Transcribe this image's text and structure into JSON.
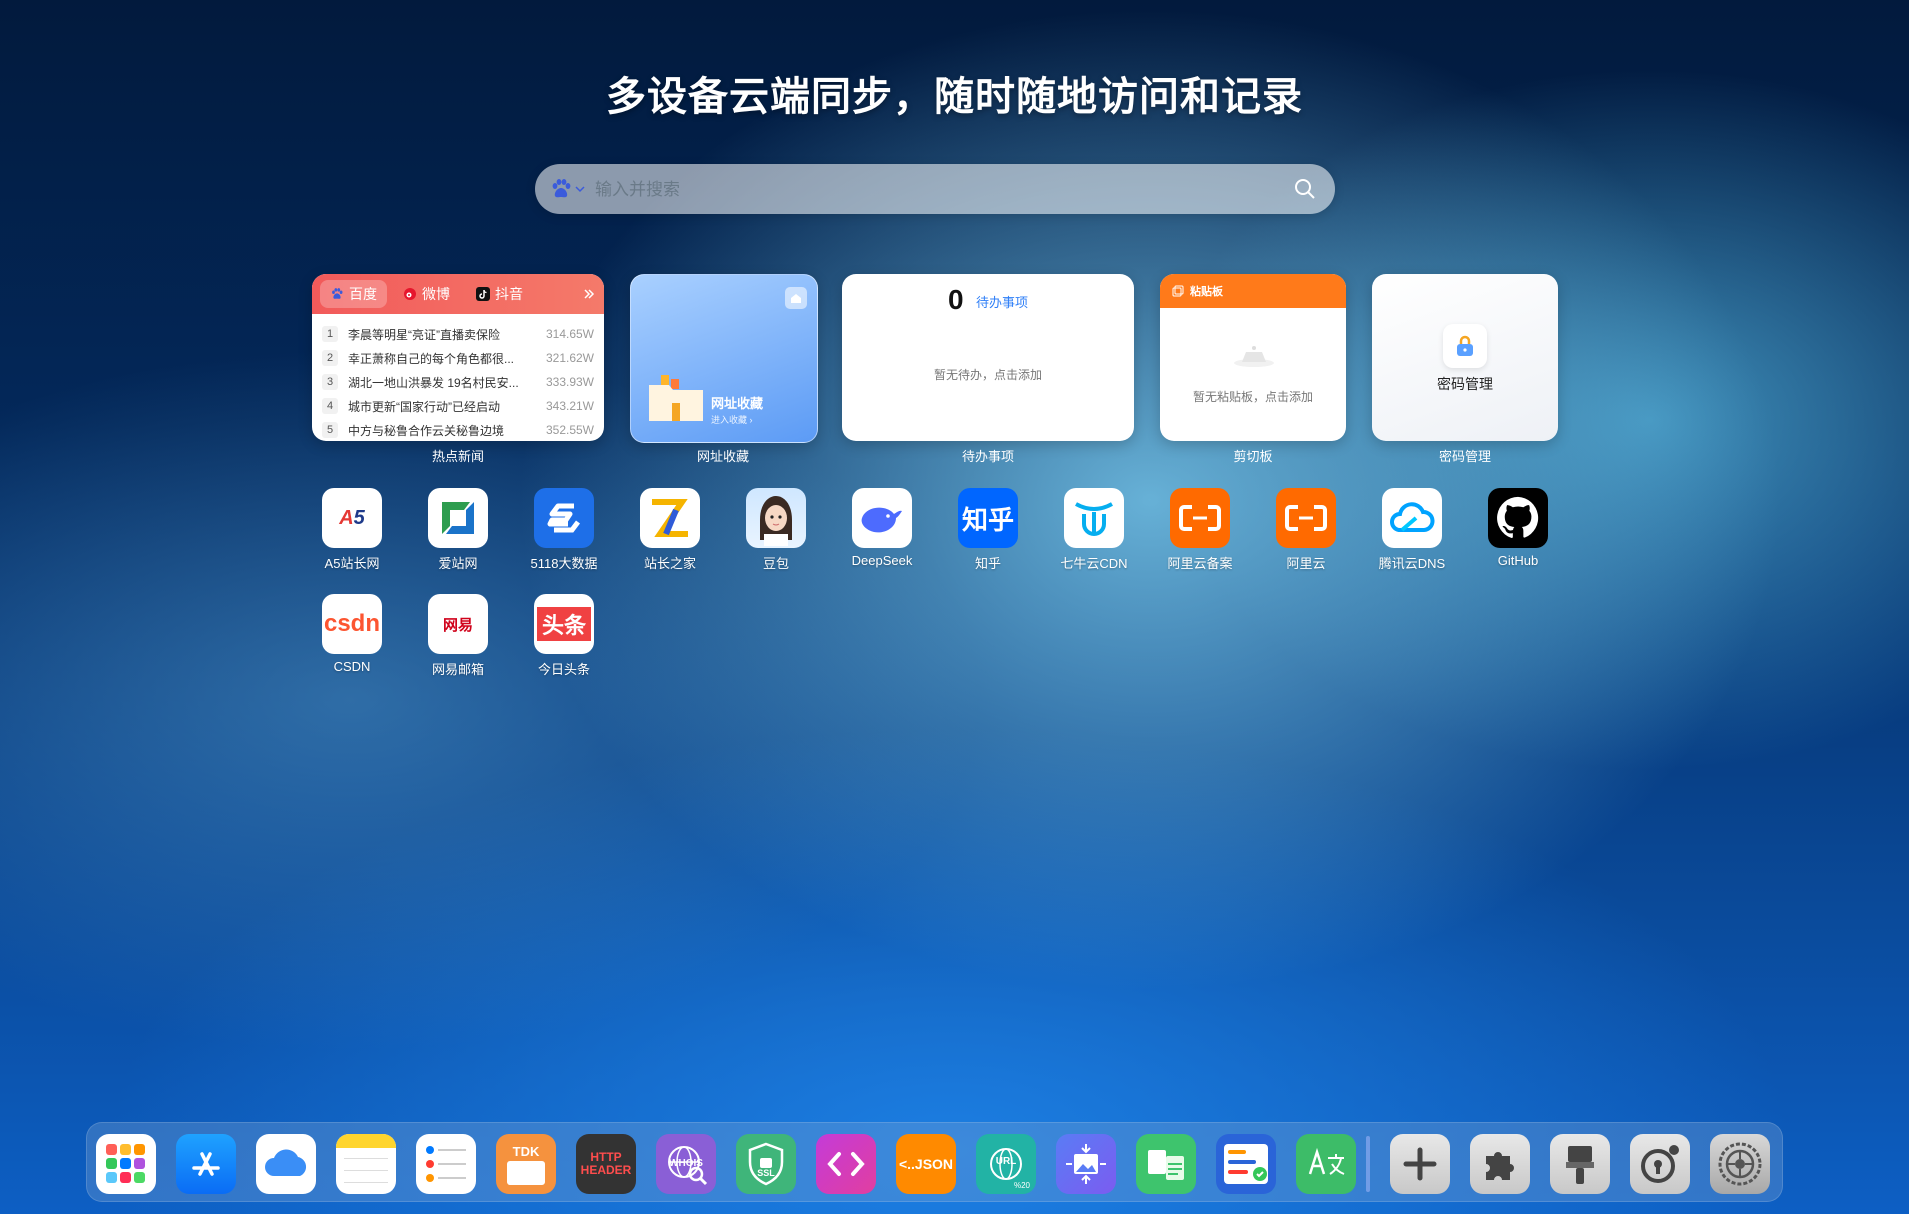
{
  "hero": {
    "title": "多设备云端同步，随时随地访问和记录"
  },
  "search": {
    "placeholder": "输入并搜索"
  },
  "news": {
    "tabs": [
      "百度",
      "微博",
      "抖音"
    ],
    "items": [
      {
        "n": "1",
        "title": "李晨等明星“亮证”直播卖保险",
        "heat": "314.65W"
      },
      {
        "n": "2",
        "title": "幸正萧称自己的每个角色都很...",
        "heat": "321.62W"
      },
      {
        "n": "3",
        "title": "湖北一地山洪暴发 19名村民安...",
        "heat": "333.93W"
      },
      {
        "n": "4",
        "title": "城市更新“国家行动”已经启动",
        "heat": "343.21W"
      },
      {
        "n": "5",
        "title": "中方与秘鲁合作云关秘鲁边境",
        "heat": "352.55W"
      }
    ],
    "label": "热点新闻"
  },
  "bookmarks": {
    "title": "网址收藏",
    "subtitle": "进入收藏 ›",
    "label": "网址收藏"
  },
  "todo": {
    "count": "0",
    "heading": "待办事项",
    "empty": "暂无待办，点击添加",
    "label": "待办事项"
  },
  "clipboard": {
    "heading": "粘贴板",
    "empty": "暂无粘贴板，点击添加",
    "label": "剪切板"
  },
  "password": {
    "title": "密码管理",
    "label": "密码管理"
  },
  "apps": [
    {
      "label": "A5站长网",
      "icon": "a5-logo-icon"
    },
    {
      "label": "爱站网",
      "icon": "aizhan-logo-icon"
    },
    {
      "label": "5118大数据",
      "icon": "5118-logo-icon"
    },
    {
      "label": "站长之家",
      "icon": "chinaz-logo-icon"
    },
    {
      "label": "豆包",
      "icon": "doubao-avatar-icon"
    },
    {
      "label": "DeepSeek",
      "icon": "deepseek-whale-icon"
    },
    {
      "label": "知乎",
      "icon": "zhihu-logo-icon",
      "text": "知乎"
    },
    {
      "label": "七牛云CDN",
      "icon": "qiniu-logo-icon"
    },
    {
      "label": "阿里云备案",
      "icon": "aliyun-logo-icon"
    },
    {
      "label": "阿里云",
      "icon": "aliyun-logo-icon"
    },
    {
      "label": "腾讯云DNS",
      "icon": "tencent-cloud-icon"
    },
    {
      "label": "GitHub",
      "icon": "github-logo-icon"
    },
    {
      "label": "CSDN",
      "icon": "csdn-logo-icon",
      "text": "csdn"
    },
    {
      "label": "网易邮箱",
      "icon": "netease-mail-icon",
      "text": "网易"
    },
    {
      "label": "今日头条",
      "icon": "toutiao-logo-icon",
      "text": "头条"
    }
  ],
  "dock": {
    "tdk": "TDK",
    "http1": "HTTP",
    "http2": "HEADER",
    "whois": "WHOIS",
    "ssl": "SSL",
    "json": "<..JSON",
    "url": "URL",
    "url_sub": "%20"
  },
  "colors": {
    "accent": "#2f7ff7",
    "news": "#f25a5a",
    "clipboard": "#ff7a1a"
  }
}
